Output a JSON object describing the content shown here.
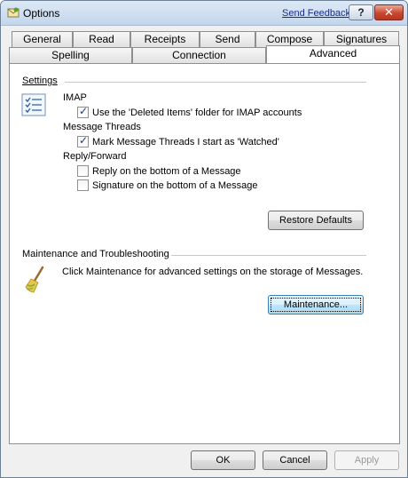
{
  "window": {
    "title": "Options",
    "send_feedback": "Send Feedback",
    "help_glyph": "?",
    "close_glyph": "✕"
  },
  "tabs_row1": [
    "General",
    "Read",
    "Receipts",
    "Send",
    "Compose",
    "Signatures"
  ],
  "tabs_row2": [
    "Spelling",
    "Connection",
    "Advanced"
  ],
  "active_tab": "Advanced",
  "settings": {
    "heading": "Settings",
    "icon": "checklist-icon",
    "imap": {
      "label": "IMAP",
      "use_deleted_items": {
        "label": "Use the 'Deleted Items' folder for IMAP accounts",
        "checked": true
      }
    },
    "message_threads": {
      "label": "Message Threads",
      "mark_watched": {
        "label": "Mark Message Threads I start as 'Watched'",
        "checked": true
      }
    },
    "reply_forward": {
      "label": "Reply/Forward",
      "reply_bottom": {
        "label": "Reply on the bottom of a Message",
        "checked": false
      },
      "signature_bottom": {
        "label": "Signature on the bottom of a Message",
        "checked": false
      }
    },
    "restore_defaults": "Restore Defaults"
  },
  "maintenance": {
    "heading": "Maintenance and Troubleshooting",
    "icon": "broom-icon",
    "description": "Click Maintenance for advanced settings on the storage of Messages.",
    "button": "Maintenance..."
  },
  "footer": {
    "ok": "OK",
    "cancel": "Cancel",
    "apply": "Apply"
  }
}
